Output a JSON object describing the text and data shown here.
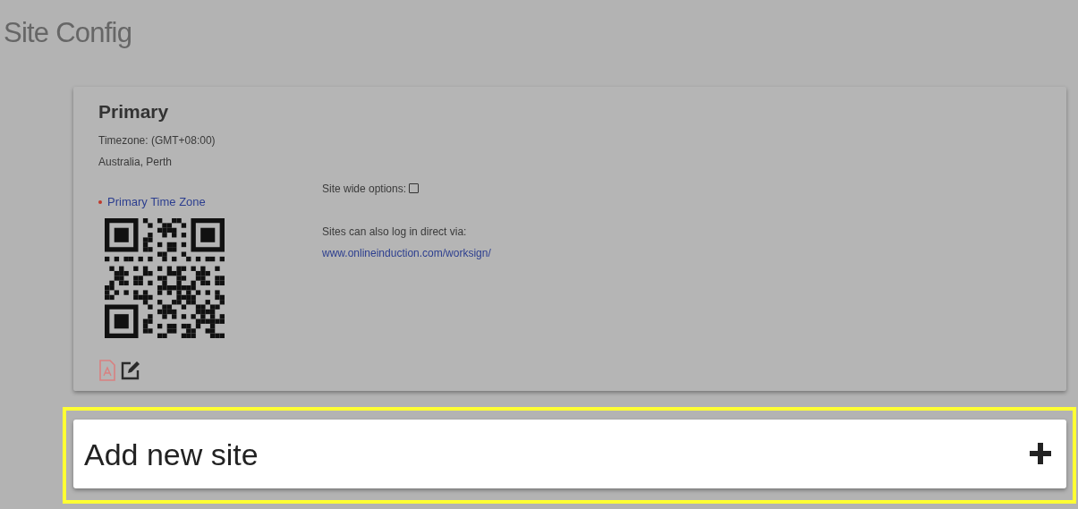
{
  "page": {
    "title": "Site Config"
  },
  "site": {
    "name": "Primary",
    "timezone": "Timezone: (GMT+08:00)",
    "city": "Australia, Perth",
    "primary_link": "Primary Time Zone",
    "site_wide_options": {
      "label": "Site wide options:",
      "checked": false
    },
    "login_note": "Sites can also log in direct via:",
    "login_url": "www.onlineinduction.com/worksign/"
  },
  "add_site": {
    "label": "Add new site",
    "highlighted": true
  }
}
